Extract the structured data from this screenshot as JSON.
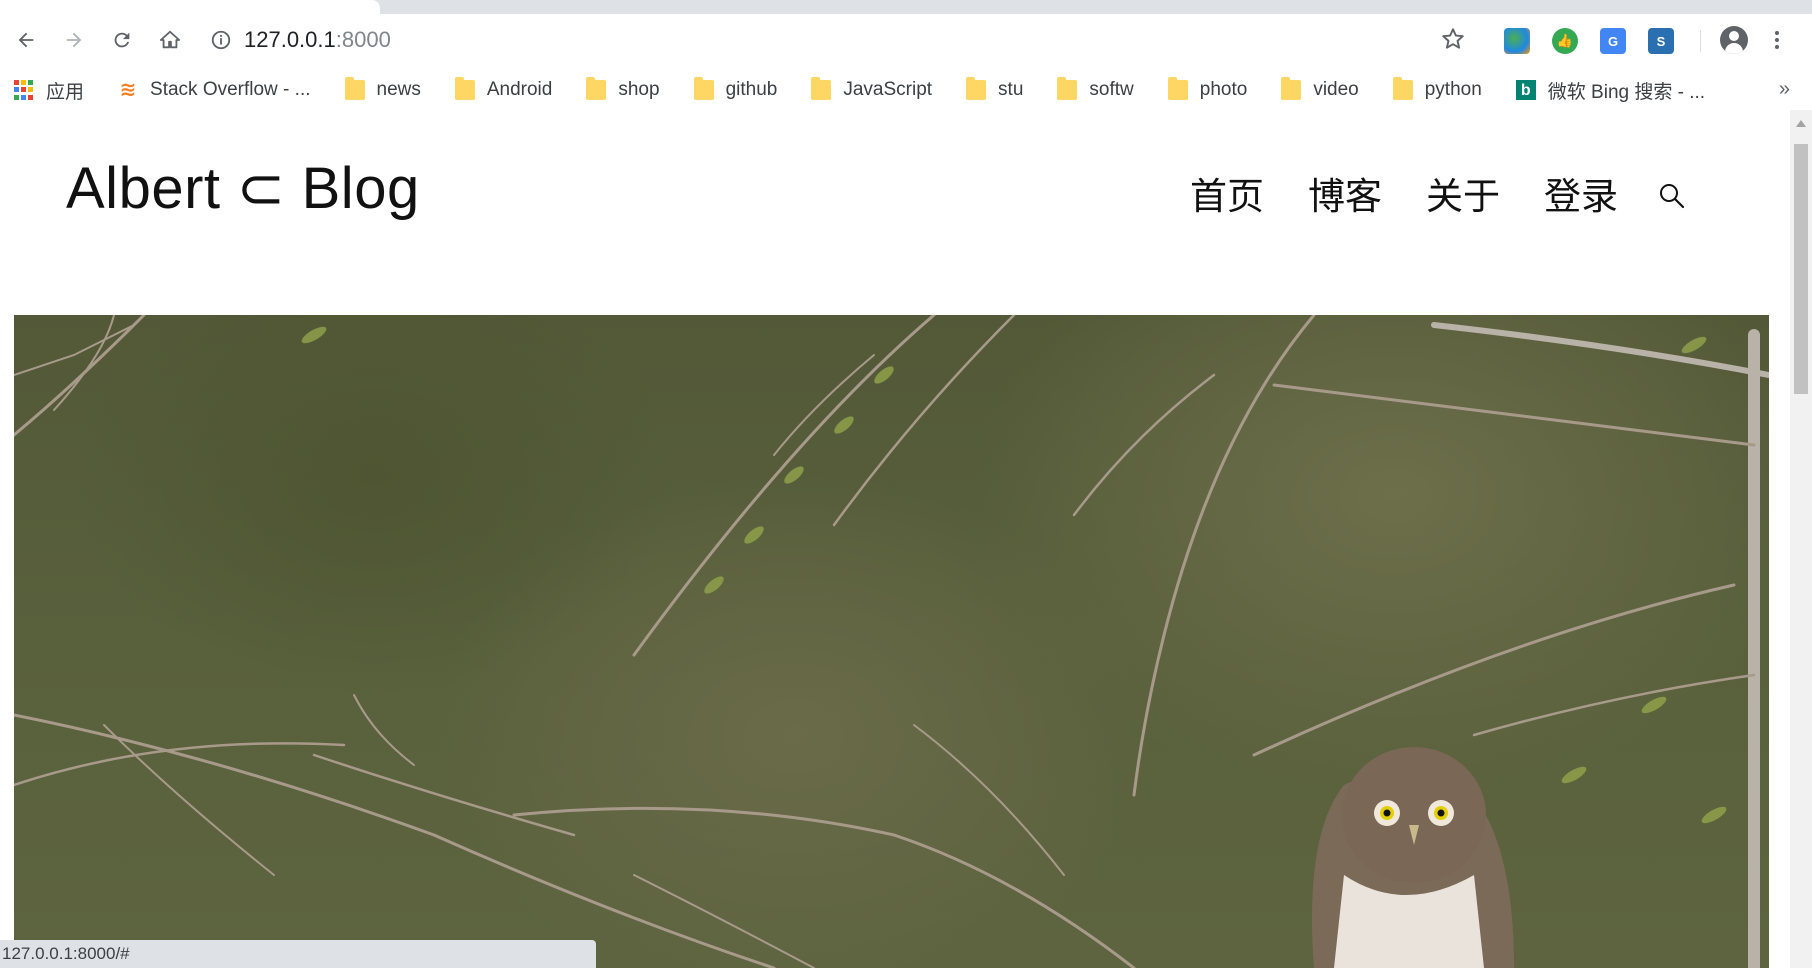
{
  "browser": {
    "url_host": "127.0.0.1",
    "url_port": ":8000",
    "bookmarks": [
      {
        "label": "应用",
        "icon": "apps-icon"
      },
      {
        "label": "Stack Overflow - ...",
        "icon": "stackoverflow-icon"
      },
      {
        "label": "news",
        "icon": "folder-icon"
      },
      {
        "label": "Android",
        "icon": "folder-icon"
      },
      {
        "label": "shop",
        "icon": "folder-icon"
      },
      {
        "label": "github",
        "icon": "folder-icon"
      },
      {
        "label": "JavaScript",
        "icon": "folder-icon"
      },
      {
        "label": "stu",
        "icon": "folder-icon"
      },
      {
        "label": "softw",
        "icon": "folder-icon"
      },
      {
        "label": "photo",
        "icon": "folder-icon"
      },
      {
        "label": "video",
        "icon": "folder-icon"
      },
      {
        "label": "python",
        "icon": "folder-icon"
      },
      {
        "label": "微软 Bing 搜索 - ...",
        "icon": "bing-icon"
      }
    ],
    "bookmarks_overflow": "»",
    "status_url": "127.0.0.1:8000/#"
  },
  "site": {
    "logo_part1": "Albert",
    "logo_symbol": "⊂",
    "logo_part2": "Blog",
    "nav": [
      "首页",
      "博客",
      "关于",
      "登录"
    ]
  },
  "colors": {
    "hero_base": "#575d3a",
    "branch": "#a99a8a",
    "leaf": "#8fa04a"
  }
}
